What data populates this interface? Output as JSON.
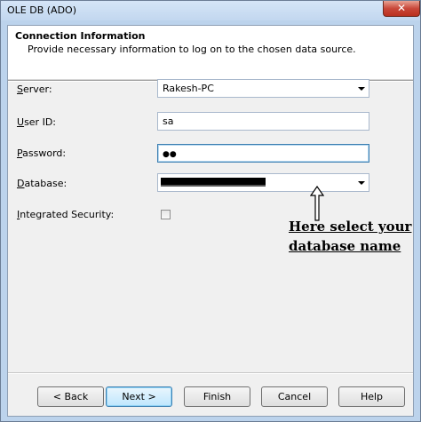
{
  "window": {
    "title": "OLE DB (ADO)",
    "close_glyph": "✕"
  },
  "header": {
    "title": "Connection Information",
    "subtitle": "Provide necessary information to log on to the chosen data source."
  },
  "form": {
    "server": {
      "label_prefix": "",
      "label_ul": "S",
      "label_rest": "erver:",
      "value": "Rakesh-PC"
    },
    "user_id": {
      "label_ul": "U",
      "label_rest": "ser ID:",
      "value": "sa"
    },
    "password": {
      "label_ul": "P",
      "label_rest": "assword:",
      "value": "●●"
    },
    "database": {
      "label_ul": "D",
      "label_rest": "atabase:",
      "value": ""
    },
    "integrated_security": {
      "label_ul": "I",
      "label_rest": "ntegrated Security:",
      "checked": false
    }
  },
  "annotation": {
    "line1": "Here select your",
    "line2": "database name"
  },
  "buttons": {
    "back": "< Back",
    "next": "Next >",
    "finish": "Finish",
    "cancel": "Cancel",
    "help": "Help"
  }
}
